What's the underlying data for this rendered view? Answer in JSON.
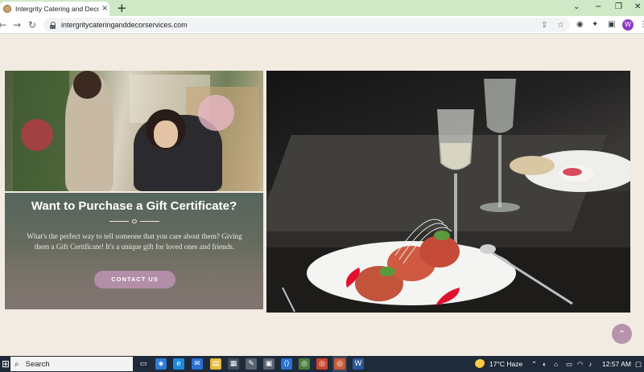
{
  "browser": {
    "tab_title": "Intergrity Catering and Decor Se",
    "tab_close": "×",
    "new_tab": "+",
    "url": "intergritycateringanddecorservices.com",
    "profile_initial": "W",
    "window_controls": [
      "⌄",
      "−",
      "❐",
      "✕"
    ]
  },
  "page": {
    "gift": {
      "title": "Want to Purchase a Gift Certificate?",
      "body": "What's the perfect way to tell someone that you care about them? Giving them a Gift Certificate! It's a unique gift for loved ones and friends.",
      "button": "CONTACT US"
    },
    "colors": {
      "page_bg": "#f1ebe1",
      "accent_button": "#b28ea9",
      "scroll_top": "#b793ad"
    }
  },
  "taskbar": {
    "search_label": "Search",
    "weather": "17°C  Haze",
    "time": "12:57 AM"
  }
}
